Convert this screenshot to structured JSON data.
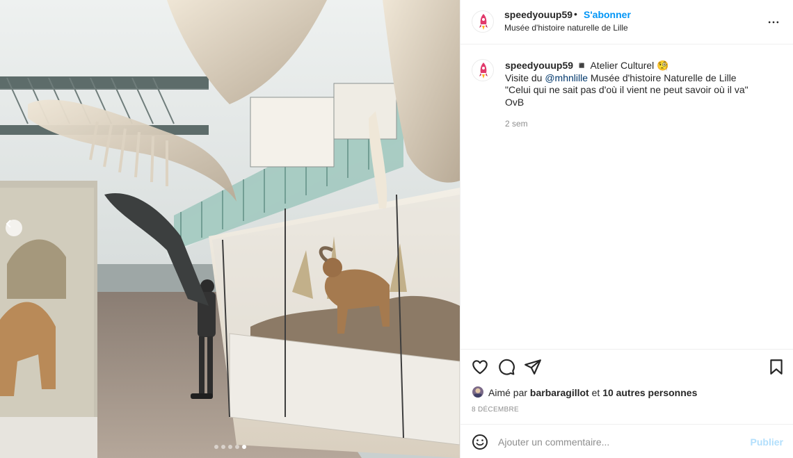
{
  "post": {
    "username": "speedyouup59",
    "separator": "•",
    "follow_label": "S'abonner",
    "location": "Musée d'histoire naturelle de Lille",
    "avatar_text": "PEED"
  },
  "caption": {
    "username": "speedyouup59",
    "line1_rest": " ◾️ Atelier Culturel 🧐",
    "line2_prefix": "Visite du ",
    "mention": "@mhnlille",
    "line2_suffix": " Musée d'histoire Naturelle de Lille",
    "line3": "\"Celui qui ne sait pas d'où il vient ne peut savoir où il va\"",
    "line4": "OvB",
    "time_ago": "2 sem"
  },
  "likes": {
    "prefix": "Aimé par ",
    "user": "barbaragillot",
    "middle": " et ",
    "others": "10 autres personnes"
  },
  "date": "8 DÉCEMBRE",
  "comment_box": {
    "placeholder": "Ajouter un commentaire...",
    "publish_label": "Publier"
  },
  "carousel": {
    "count": 5,
    "active_index": 4
  },
  "colors": {
    "link_blue": "#0095f6",
    "publish_disabled": "#b2dffc",
    "muted": "#8e8e8e",
    "border": "#efefef"
  },
  "icons": [
    "heart-icon",
    "comment-icon",
    "share-icon",
    "bookmark-icon",
    "more-icon",
    "emoji-icon",
    "chevron-left-icon"
  ]
}
